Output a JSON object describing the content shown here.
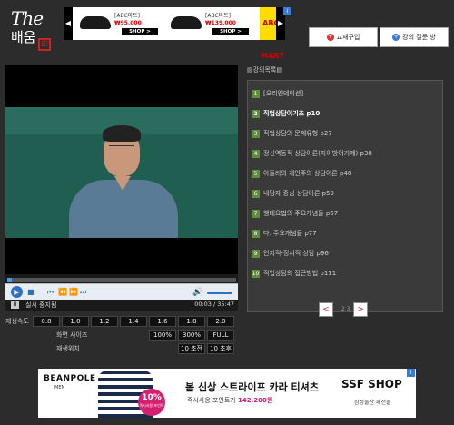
{
  "logo": {
    "the": "The",
    "baeum": "배움"
  },
  "top_ad": {
    "items": [
      {
        "name": "[ABC마트]···",
        "price": "₩95,000",
        "shop": "SHOP >"
      },
      {
        "name": "[ABC마트]···",
        "price": "₩139,000",
        "shop": "SHOP >"
      }
    ],
    "brand": "ABC-MART",
    "left_arrow": "◀",
    "right_arrow": "▶",
    "info": "i"
  },
  "buttons": {
    "book": "교재구입",
    "qa": "강의 질문 방"
  },
  "player": {
    "live_label": "실시 중지됨",
    "time": "00:03 / 35:47",
    "play_icon": "▶",
    "pause_icon": "II"
  },
  "speed": {
    "label": "재생속도",
    "options": [
      "0.8",
      "1.0",
      "1.2",
      "1.4",
      "1.6",
      "1.8",
      "2.0"
    ]
  },
  "screen_size": {
    "label": "화면 사이즈",
    "options": [
      "100%",
      "300%",
      "FULL"
    ]
  },
  "position": {
    "label": "재생위치",
    "options": [
      "10 초전",
      "10 초후"
    ]
  },
  "lecture_list": {
    "title": "▤강의목록▤",
    "items": [
      {
        "num": "1",
        "title": "[오리엔테이션]"
      },
      {
        "num": "2",
        "title": "직업상담이기초 p10"
      },
      {
        "num": "3",
        "title": "직업상담의 문제유형 p27"
      },
      {
        "num": "4",
        "title": "정신역동적 상담이론(자아방어기제) p38"
      },
      {
        "num": "5",
        "title": "아들러의 개인주의 상담이론 p48"
      },
      {
        "num": "6",
        "title": "내담자 중심 상담이론 p59"
      },
      {
        "num": "7",
        "title": "행태요법의 주요개념들 p67"
      },
      {
        "num": "8",
        "title": "다. 주요개념들 p77"
      },
      {
        "num": "9",
        "title": "인지적-정서적 상담 p96"
      },
      {
        "num": "10",
        "title": "직업상담의 접근방법 p111"
      }
    ],
    "pager": {
      "prev": "<",
      "next": ">",
      "pages": "2 3"
    }
  },
  "bottom_ad": {
    "brand": "BEANPOLE",
    "brand_sub": "MEN",
    "badge_pct": "10%",
    "badge_text": "즉시사용 포인트",
    "headline": "봄 신상 스트라이프 카라 티셔츠",
    "sub_prefix": "즉시사용 포인트가",
    "sub_amount": "142,200원",
    "shop": "SSF SHOP",
    "shop_sub": "삼성물산 패션몰",
    "info": "i"
  },
  "colors": {
    "accent_green": "#5c8e3c",
    "player_blue": "#2d6fc0",
    "badge_pink": "#d61f6f"
  }
}
